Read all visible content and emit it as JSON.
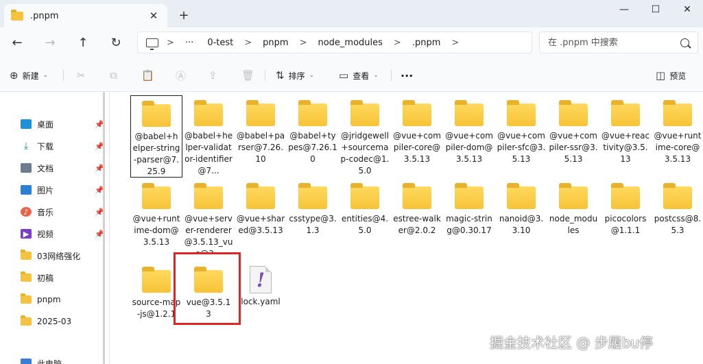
{
  "tab": {
    "title": ".pnpm",
    "close": "✕",
    "new": "+"
  },
  "window": {
    "minimize": "—",
    "maximize": "☐",
    "close": "✕"
  },
  "nav": {
    "back": "←",
    "forward": "→",
    "up": "↑",
    "refresh": "↻"
  },
  "address": {
    "more": "···",
    "crumbs": [
      "0-test",
      "pnpm",
      "node_modules",
      ".pnpm"
    ],
    "sep": ">"
  },
  "search": {
    "placeholder": "在 .pnpm 中搜索"
  },
  "toolbar": {
    "new_label": "新建",
    "sort_label": "排序",
    "view_label": "查看",
    "more": "···",
    "preview_label": "预览"
  },
  "sidebar": {
    "items": [
      {
        "label": "桌面",
        "icon": "desktop-icon",
        "color": "#1f8fd6",
        "pinned": true
      },
      {
        "label": "下载",
        "icon": "download-icon",
        "color": "#1f9a6a",
        "pinned": true
      },
      {
        "label": "文档",
        "icon": "document-icon",
        "color": "#6d7b8c",
        "pinned": true
      },
      {
        "label": "图片",
        "icon": "picture-icon",
        "color": "#2d7fd3",
        "pinned": true
      },
      {
        "label": "音乐",
        "icon": "music-icon",
        "color": "#e2664c",
        "pinned": true
      },
      {
        "label": "视频",
        "icon": "video-icon",
        "color": "#7b3fc4",
        "pinned": true
      },
      {
        "label": "03网络强化",
        "icon": "folder-icon",
        "pinned": false
      },
      {
        "label": "初稿",
        "icon": "folder-icon",
        "pinned": false
      },
      {
        "label": "pnpm",
        "icon": "folder-icon",
        "pinned": false
      },
      {
        "label": "2025-03",
        "icon": "folder-icon",
        "pinned": false
      }
    ],
    "pc_label": "此电脑",
    "pin_glyph": "📌"
  },
  "files": [
    {
      "label": "@babel+helper-string-parser@7.25.9",
      "type": "folder"
    },
    {
      "label": "@babel+helper-validator-identifier@7...",
      "type": "folder"
    },
    {
      "label": "@babel+parser@7.26.10",
      "type": "folder"
    },
    {
      "label": "@babel+types@7.26.10",
      "type": "folder"
    },
    {
      "label": "@jridgewell+sourcemap-codec@1.5.0",
      "type": "folder"
    },
    {
      "label": "@vue+compiler-core@3.5.13",
      "type": "folder"
    },
    {
      "label": "@vue+compiler-dom@3.5.13",
      "type": "folder"
    },
    {
      "label": "@vue+compiler-sfc@3.5.13",
      "type": "folder"
    },
    {
      "label": "@vue+compiler-ssr@3.5.13",
      "type": "folder"
    },
    {
      "label": "@vue+reactivity@3.5.13",
      "type": "folder"
    },
    {
      "label": "@vue+runtime-core@3.5.13",
      "type": "folder"
    },
    {
      "label": "@vue+runtime-dom@3.5.13",
      "type": "folder"
    },
    {
      "label": "@vue+server-renderer@3.5.13_vue@3...",
      "type": "folder"
    },
    {
      "label": "@vue+shared@3.5.13",
      "type": "folder"
    },
    {
      "label": "csstype@3.1.3",
      "type": "folder"
    },
    {
      "label": "entities@4.5.0",
      "type": "folder"
    },
    {
      "label": "estree-walker@2.0.2",
      "type": "folder"
    },
    {
      "label": "magic-string@0.30.17",
      "type": "folder"
    },
    {
      "label": "nanoid@3.3.10",
      "type": "folder"
    },
    {
      "label": "node_modules",
      "type": "folder"
    },
    {
      "label": "picocolors@1.1.1",
      "type": "folder"
    },
    {
      "label": "postcss@8.5.3",
      "type": "folder"
    },
    {
      "label": "source-map-js@1.2.1",
      "type": "folder"
    },
    {
      "label": "vue@3.5.13",
      "type": "folder"
    },
    {
      "label": "lock.yaml",
      "type": "yaml",
      "glyph": "!"
    }
  ],
  "watermark": "掘金技术社区 @ 步履bu停",
  "colors": {
    "highlight": "#e02424",
    "folder": "#f7c337"
  }
}
